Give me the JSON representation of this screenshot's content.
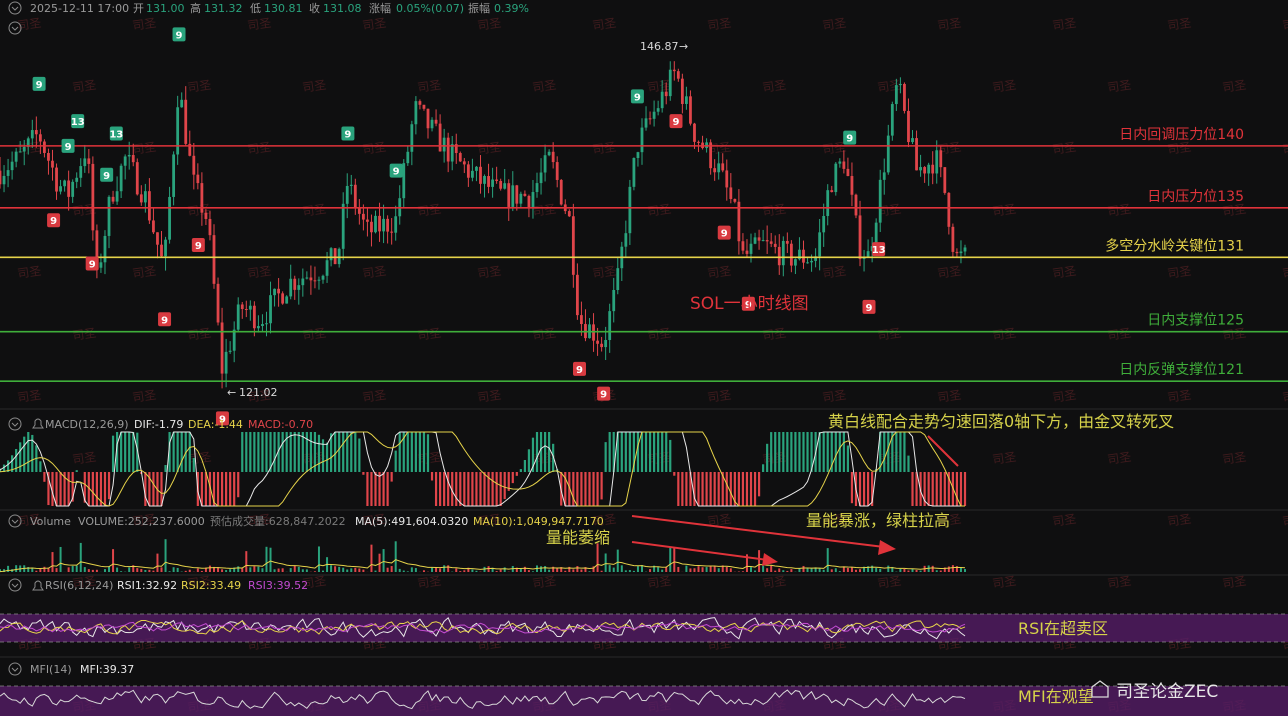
{
  "header": {
    "datetime": "2025-12-11 17:00",
    "open_label": "开",
    "open": "131.00",
    "high_label": "高",
    "high": "131.32",
    "low_label": "低",
    "low": "130.81",
    "close_label": "收",
    "close": "131.08",
    "change_label": "涨幅",
    "change": "0.05%(0.07)",
    "amp_label": "振幅",
    "amp": "0.39%"
  },
  "chart_title": "SOL一小时线图",
  "watermark": "司圣",
  "footer_brand": "司圣论金ZEC",
  "colors": {
    "up": "#2aa37d",
    "down": "#e0454a",
    "red_line": "#e0333a",
    "yellow_line": "#e6d34a",
    "green_line": "#3fae3a",
    "purple_band": "#5a1d6b"
  },
  "chart_data": [
    {
      "type": "candlestick",
      "title": "SOL一小时线图",
      "ylim": [
        119,
        150
      ],
      "high_marker": "146.87",
      "low_marker": "121.02",
      "levels": [
        {
          "value": 140,
          "label": "日内回调压力位140",
          "color": "#e0333a"
        },
        {
          "value": 135,
          "label": "日内压力位135",
          "color": "#e0333a"
        },
        {
          "value": 131,
          "label": "多空分水岭关键位131",
          "color": "#e6d34a"
        },
        {
          "value": 125,
          "label": "日内支撑位125",
          "color": "#3fae3a"
        },
        {
          "value": 121,
          "label": "日内反弹支撑位121",
          "color": "#3fae3a"
        }
      ],
      "td_sequential": [
        {
          "x": 0.04,
          "value": "9",
          "dir": "up"
        },
        {
          "x": 0.08,
          "value": "13",
          "dir": "up"
        },
        {
          "x": 0.07,
          "value": "9",
          "dir": "up"
        },
        {
          "x": 0.12,
          "value": "13",
          "dir": "up"
        },
        {
          "x": 0.11,
          "value": "9",
          "dir": "up"
        },
        {
          "x": 0.185,
          "value": "9",
          "dir": "up"
        },
        {
          "x": 0.36,
          "value": "9",
          "dir": "up"
        },
        {
          "x": 0.41,
          "value": "9",
          "dir": "up"
        },
        {
          "x": 0.66,
          "value": "9",
          "dir": "up"
        },
        {
          "x": 0.88,
          "value": "9",
          "dir": "up"
        },
        {
          "x": 0.055,
          "value": "9",
          "dir": "down"
        },
        {
          "x": 0.095,
          "value": "9",
          "dir": "down"
        },
        {
          "x": 0.17,
          "value": "9",
          "dir": "down"
        },
        {
          "x": 0.205,
          "value": "9",
          "dir": "down"
        },
        {
          "x": 0.23,
          "value": "9",
          "dir": "down"
        },
        {
          "x": 0.6,
          "value": "9",
          "dir": "down"
        },
        {
          "x": 0.625,
          "value": "9",
          "dir": "down"
        },
        {
          "x": 0.7,
          "value": "9",
          "dir": "down"
        },
        {
          "x": 0.75,
          "value": "9",
          "dir": "down"
        },
        {
          "x": 0.775,
          "value": "9",
          "dir": "down"
        },
        {
          "x": 0.9,
          "value": "9",
          "dir": "down"
        },
        {
          "x": 0.91,
          "value": "13",
          "dir": "down"
        }
      ],
      "price_path": [
        [
          0.0,
          138
        ],
        [
          0.02,
          139
        ],
        [
          0.04,
          141
        ],
        [
          0.06,
          137
        ],
        [
          0.07,
          136
        ],
        [
          0.09,
          140
        ],
        [
          0.1,
          129
        ],
        [
          0.115,
          136
        ],
        [
          0.13,
          139
        ],
        [
          0.15,
          136
        ],
        [
          0.17,
          130
        ],
        [
          0.185,
          145
        ],
        [
          0.2,
          137
        ],
        [
          0.215,
          134
        ],
        [
          0.23,
          122
        ],
        [
          0.25,
          127
        ],
        [
          0.27,
          126
        ],
        [
          0.3,
          129
        ],
        [
          0.33,
          130
        ],
        [
          0.35,
          131
        ],
        [
          0.36,
          137
        ],
        [
          0.38,
          133
        ],
        [
          0.41,
          134
        ],
        [
          0.43,
          143
        ],
        [
          0.45,
          141
        ],
        [
          0.47,
          139
        ],
        [
          0.5,
          137
        ],
        [
          0.52,
          136
        ],
        [
          0.55,
          136
        ],
        [
          0.57,
          139
        ],
        [
          0.59,
          134
        ],
        [
          0.6,
          126
        ],
        [
          0.615,
          125
        ],
        [
          0.625,
          124
        ],
        [
          0.64,
          129
        ],
        [
          0.66,
          140
        ],
        [
          0.68,
          143
        ],
        [
          0.7,
          146
        ],
        [
          0.72,
          141
        ],
        [
          0.745,
          138
        ],
        [
          0.76,
          135
        ],
        [
          0.77,
          131
        ],
        [
          0.79,
          132
        ],
        [
          0.82,
          131
        ],
        [
          0.845,
          131
        ],
        [
          0.86,
          137
        ],
        [
          0.875,
          139
        ],
        [
          0.89,
          132
        ],
        [
          0.9,
          131
        ],
        [
          0.93,
          145
        ],
        [
          0.95,
          138
        ],
        [
          0.97,
          139
        ],
        [
          0.98,
          136
        ],
        [
          0.99,
          131
        ],
        [
          1.0,
          131
        ]
      ]
    },
    {
      "type": "macd",
      "label": "MACD(12,26,9)",
      "dif_label": "DIF:-1.79",
      "dea_label": "DEA:-1.44",
      "macd_label": "MACD:-0.70",
      "annotation": "黄白线配合走势匀速回落0轴下方，由金叉转死叉"
    },
    {
      "type": "volume",
      "label": "Volume",
      "volume_label": "VOLUME:252,237.6000",
      "forecast_label": "预估成交量:628,847.2022",
      "ma5_label": "MA(5):491,604.0320",
      "ma10_label": "MA(10):1,049,947.7170",
      "annotation_shrink": "量能萎缩",
      "annotation_surge": "量能暴涨，绿柱拉高"
    },
    {
      "type": "rsi",
      "label": "RSI(6,12,24)",
      "rsi1_label": "RSI1:32.92",
      "rsi2_label": "RSI2:33.49",
      "rsi3_label": "RSI3:39.52",
      "annotation": "RSI在超卖区"
    },
    {
      "type": "mfi",
      "label": "MFI(14)",
      "mfi_label": "MFI:39.37",
      "annotation": "MFI在观望"
    }
  ]
}
